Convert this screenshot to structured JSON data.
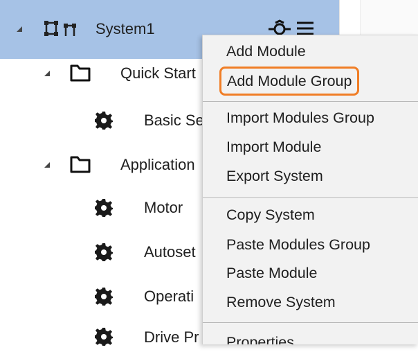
{
  "tree": {
    "nodes": [
      {
        "label": "System1",
        "icon": "system-icon"
      },
      {
        "label": "Quick Start",
        "icon": "folder-icon"
      },
      {
        "label": "Basic Se",
        "icon": "gear-icon"
      },
      {
        "label": "Application",
        "icon": "folder-icon"
      },
      {
        "label": "Motor",
        "icon": "gear-icon"
      },
      {
        "label": "Autoset",
        "icon": "gear-icon"
      },
      {
        "label": "Operati",
        "icon": "gear-icon"
      },
      {
        "label": "Drive Pr",
        "icon": "gear-icon"
      }
    ],
    "selected_row_color": "#a6c2e6"
  },
  "context_menu": {
    "items": [
      {
        "label": "Add Module"
      },
      {
        "label": "Add Module Group",
        "highlighted": true
      },
      {
        "label": "Import Modules Group"
      },
      {
        "label": "Import Module"
      },
      {
        "label": "Export System"
      },
      {
        "label": "Copy System"
      },
      {
        "label": "Paste Modules Group"
      },
      {
        "label": "Paste Module"
      },
      {
        "label": "Remove System"
      },
      {
        "label": "Properties"
      }
    ],
    "highlight_color": "#f07d25",
    "background": "#f2f2f2"
  }
}
